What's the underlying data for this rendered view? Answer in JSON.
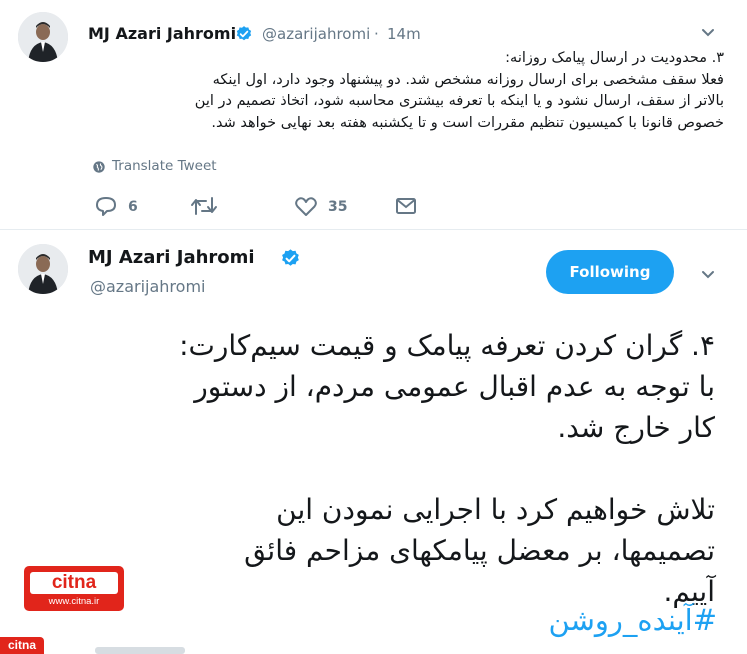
{
  "tweet1": {
    "author_name": "MJ Azari Jahromi",
    "handle": "@azarijahromi",
    "separator": "·",
    "time": "14m",
    "lines": [
      "۳. محدودیت در ارسال پیامک روزانه:",
      "فعلا سقف مشخصی برای ارسال روزانه مشخص شد. دو پیشنهاد وجود دارد، اول اینکه",
      "بالاتر از سقف، ارسال نشود و یا اینکه با تعرفه بیشتری محاسبه شود، اتخاذ تصمیم در این",
      "خصوص قانونا با کمیسیون تنظیم مقررات است و تا یکشنبه هفته بعد نهایی خواهد شد."
    ],
    "translate_label": "Translate Tweet",
    "reply_count": "6",
    "like_count": "35"
  },
  "tweet2": {
    "author_name": "MJ Azari Jahromi",
    "handle": "@azarijahromi",
    "follow_label": "Following",
    "lines": [
      "۴. گران کردن تعرفه پیامک و قیمت سیم‌کارت:",
      "با توجه به عدم اقبال عمومی مردم، از دستور",
      "کار خارج شد.",
      "",
      "تلاش خواهیم کرد با اجرایی نمودن این",
      "تصمیمها، بر معضل پیامکهای مزاحم فائق",
      "آییم."
    ],
    "hashtag": "#آینده_روشن"
  },
  "watermark": {
    "logo_text": "citna",
    "url": "www.citna.ir",
    "corner_text": "citna"
  },
  "colors": {
    "accent": "#1da1f2",
    "verified": "#1da1f2",
    "muted": "#657786",
    "logo": "#e1251b"
  }
}
